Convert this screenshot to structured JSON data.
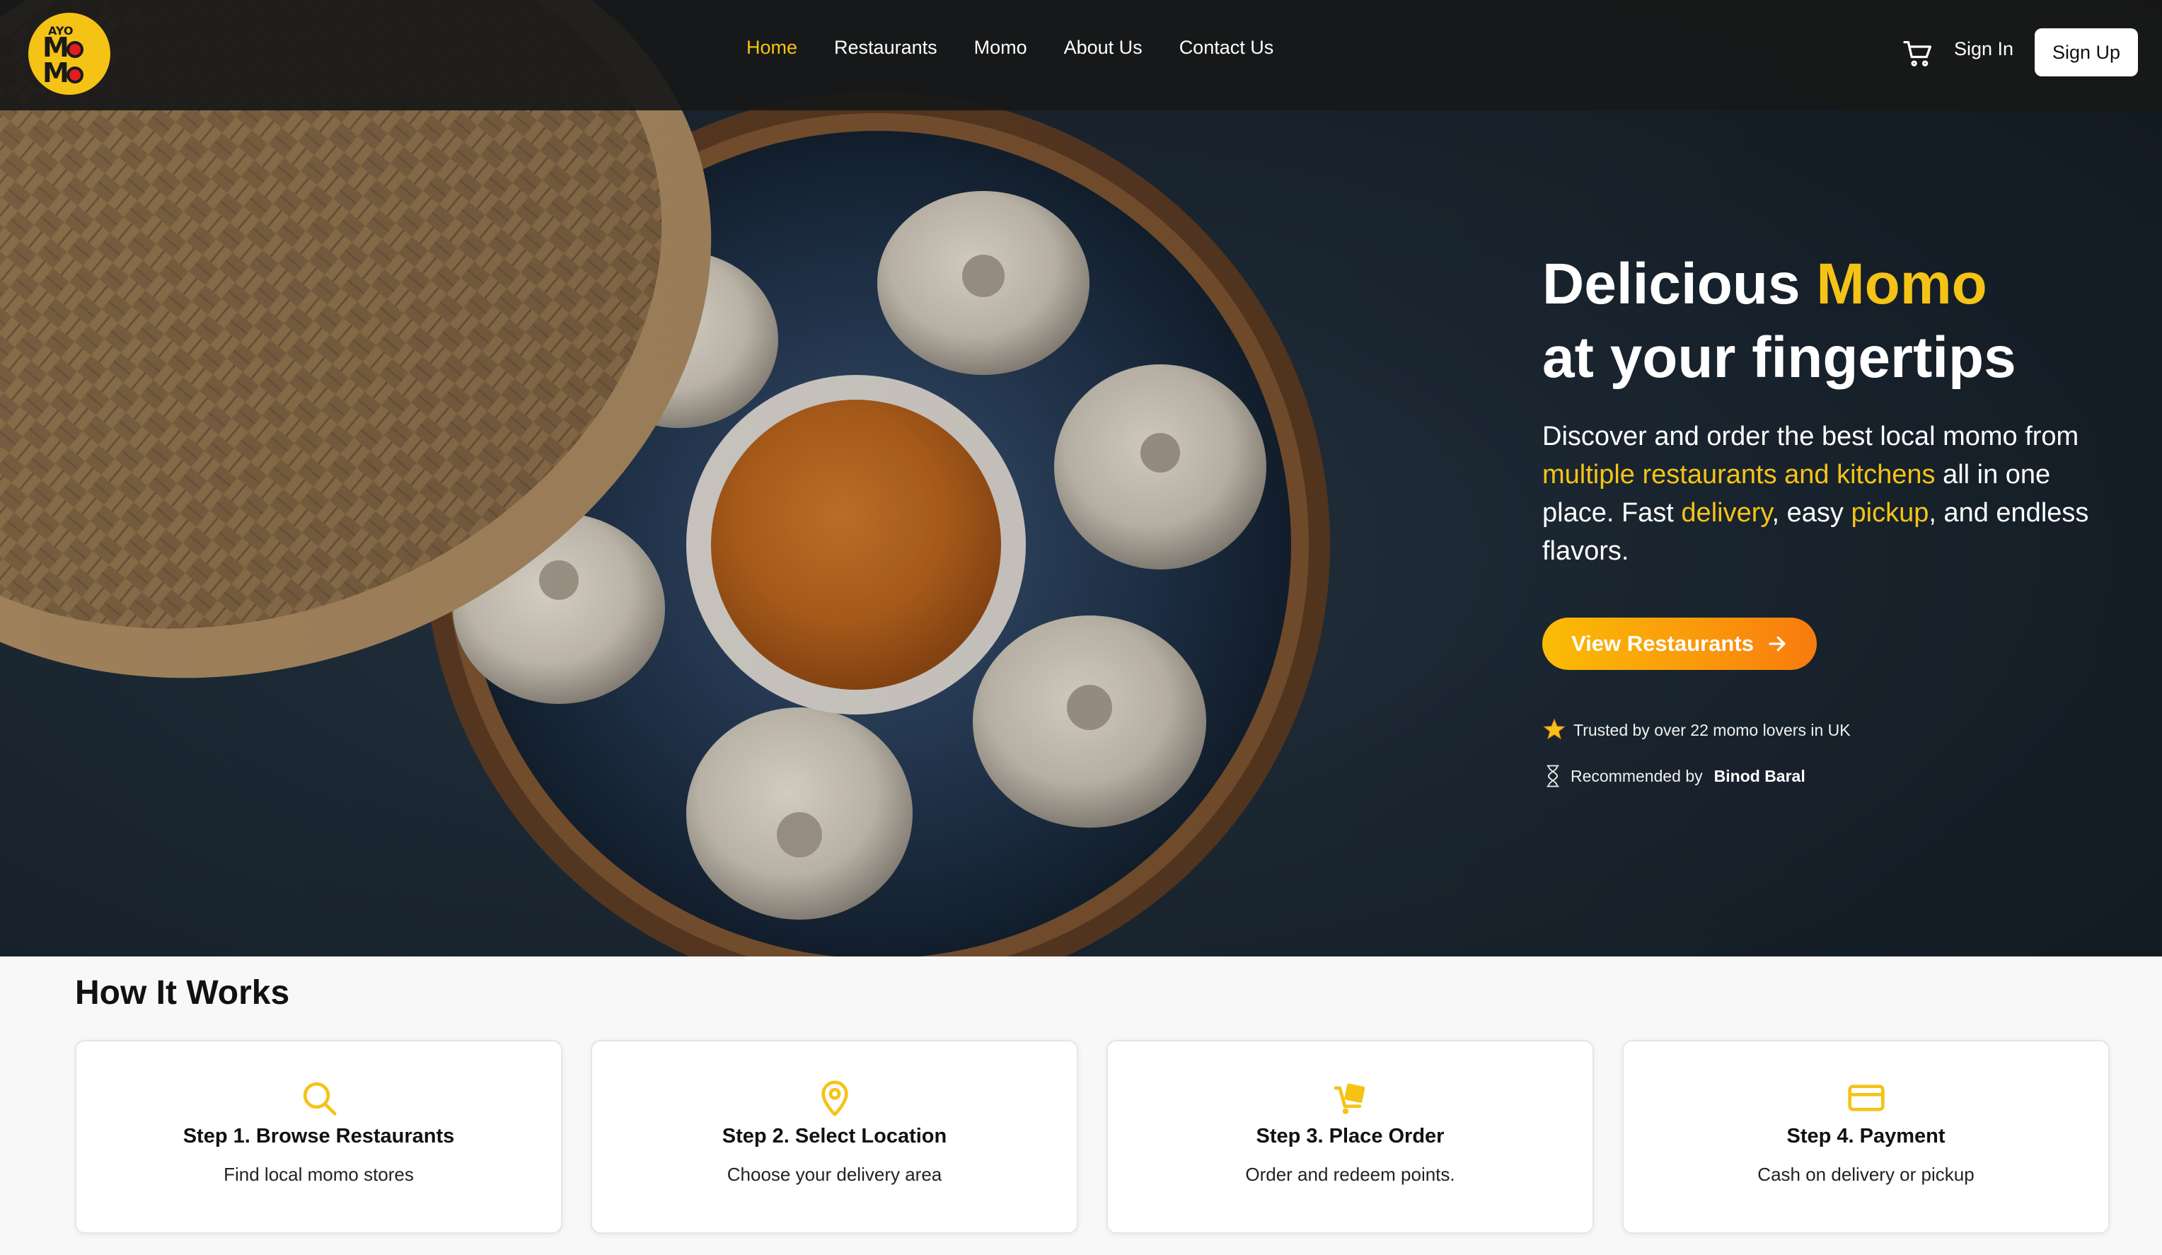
{
  "brand": {
    "logo_top": "AYO",
    "logo_row1": "M M",
    "logo_row2": "M 8"
  },
  "nav": {
    "links": [
      {
        "label": "Home",
        "active": true
      },
      {
        "label": "Restaurants"
      },
      {
        "label": "Momo"
      },
      {
        "label": "About Us"
      },
      {
        "label": "Contact Us"
      }
    ],
    "signin": "Sign In",
    "signup": "Sign Up",
    "cart_icon": "cart-icon"
  },
  "hero": {
    "title_part1": "Delicious ",
    "title_highlight": "Momo",
    "title_part2": "at your fingertips",
    "desc_1": "Discover and order the best local momo from ",
    "desc_hl_1": "multiple restaurants and kitchens",
    "desc_2": " all in one place. Fast ",
    "desc_hl_2": "delivery",
    "desc_3": ", easy ",
    "desc_hl_3": "pickup",
    "desc_4": ", and endless flavors.",
    "cta": "View Restaurants",
    "trust_1": "Trusted by over 22 momo lovers in UK",
    "trust_2_prefix": "Recommended by",
    "trust_2_name": "Binod Baral"
  },
  "how": {
    "title": "How It Works",
    "steps": [
      {
        "title": "Step 1. Browse Restaurants",
        "desc": "Find local momo stores",
        "icon": "search-icon"
      },
      {
        "title": "Step 2. Select Location",
        "desc": "Choose your delivery area",
        "icon": "location-pin-icon"
      },
      {
        "title": "Step 3. Place Order",
        "desc": "Order and redeem points.",
        "icon": "delivery-cart-icon"
      },
      {
        "title": "Step 4. Payment",
        "desc": "Cash on delivery or pickup",
        "icon": "credit-card-icon"
      }
    ]
  },
  "colors": {
    "accent": "#f5c316",
    "cta_start": "#fbbc05",
    "cta_end": "#f77b0e",
    "nav_bg": "#181818"
  }
}
